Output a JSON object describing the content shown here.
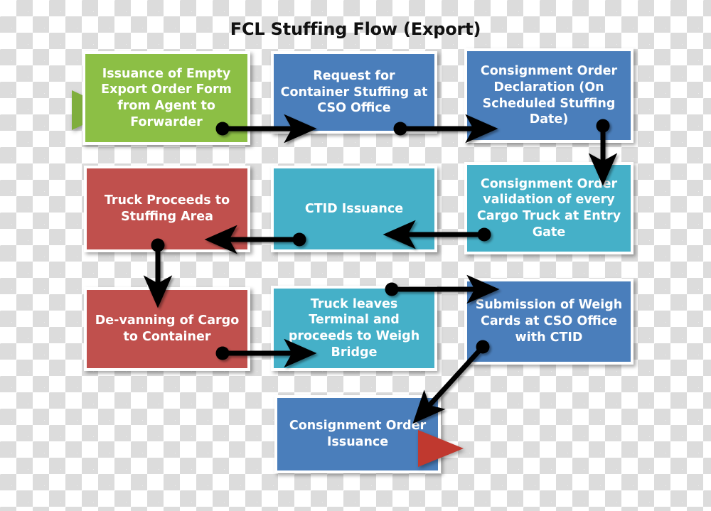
{
  "diagram": {
    "title": "FCL Stuffing Flow (Export)",
    "colors": {
      "green": "#8cbf45",
      "blue": "#4a7ebb",
      "teal": "#45b0c8",
      "red": "#c0504d",
      "arrow": "#000000",
      "entry_marker": "#7fae3c",
      "exit_marker": "#c0392f",
      "title_text": "#111111",
      "node_text": "#ffffff"
    },
    "nodes": [
      {
        "id": "n1",
        "label": "Issuance of Empty Export Order Form from Agent  to Forwarder",
        "color": "green"
      },
      {
        "id": "n2",
        "label": "Request for Container Stuffing at CSO Office",
        "color": "blue"
      },
      {
        "id": "n3",
        "label": "Consignment Order Declaration (On Scheduled Stuffing Date)",
        "color": "blue"
      },
      {
        "id": "n4",
        "label": "Truck Proceeds to Stuffing Area",
        "color": "red"
      },
      {
        "id": "n5",
        "label": "CTID Issuance",
        "color": "teal"
      },
      {
        "id": "n6",
        "label": "Consignment Order validation of every Cargo Truck at Entry Gate",
        "color": "teal"
      },
      {
        "id": "n7",
        "label": "De-vanning of Cargo to Container",
        "color": "red"
      },
      {
        "id": "n8",
        "label": "Truck leaves Terminal and proceeds to Weigh Bridge",
        "color": "teal"
      },
      {
        "id": "n9",
        "label": "Submission of Weigh Cards at CSO Office with CTID",
        "color": "blue"
      },
      {
        "id": "n10",
        "label": "Consignment Order Issuance",
        "color": "blue"
      }
    ],
    "markers": {
      "entry_label": "process-entry-marker",
      "exit_label": "process-exit-marker"
    },
    "connections": [
      {
        "from": "n1",
        "to": "n2",
        "direction": "right"
      },
      {
        "from": "n2",
        "to": "n3",
        "direction": "right"
      },
      {
        "from": "n3",
        "to": "n6",
        "direction": "down"
      },
      {
        "from": "n6",
        "to": "n5",
        "direction": "left"
      },
      {
        "from": "n5",
        "to": "n4",
        "direction": "left"
      },
      {
        "from": "n4",
        "to": "n7",
        "direction": "down"
      },
      {
        "from": "n7",
        "to": "n8",
        "direction": "right"
      },
      {
        "from": "n8",
        "to": "n9",
        "direction": "right"
      },
      {
        "from": "n9",
        "to": "n10",
        "direction": "diagonal-down-left"
      }
    ]
  }
}
